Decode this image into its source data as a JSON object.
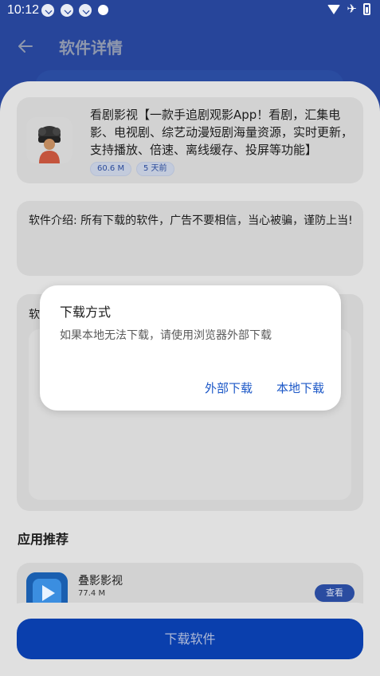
{
  "status_bar": {
    "time": "10:12"
  },
  "header": {
    "title": "软件详情"
  },
  "app": {
    "description": "看剧影视【一款手追剧观影App！看剧，汇集电影、电视剧、综艺动漫短剧海量资源，实时更新，支持播放、倍速、离线缓存、投屏等功能】",
    "size": "60.6 M",
    "updated": "5 天前"
  },
  "intro": {
    "text": "软件介绍: 所有下载的软件，广告不要相信，当心被骗，谨防上当!"
  },
  "screenshots": {
    "label": "软"
  },
  "recommend": {
    "title": "应用推荐",
    "items": [
      {
        "name": "叠影影视",
        "size": "77.4 M",
        "button": "查看"
      }
    ]
  },
  "download_button": "下载软件",
  "dialog": {
    "title": "下载方式",
    "message": "如果本地无法下载，请使用浏览器外部下载",
    "external_label": "外部下载",
    "local_label": "本地下载"
  },
  "colors": {
    "header_bg": "#27459a",
    "primary_button": "#0a3fad",
    "dialog_action": "#1b57c7",
    "tag_text": "#2b4b9a"
  }
}
